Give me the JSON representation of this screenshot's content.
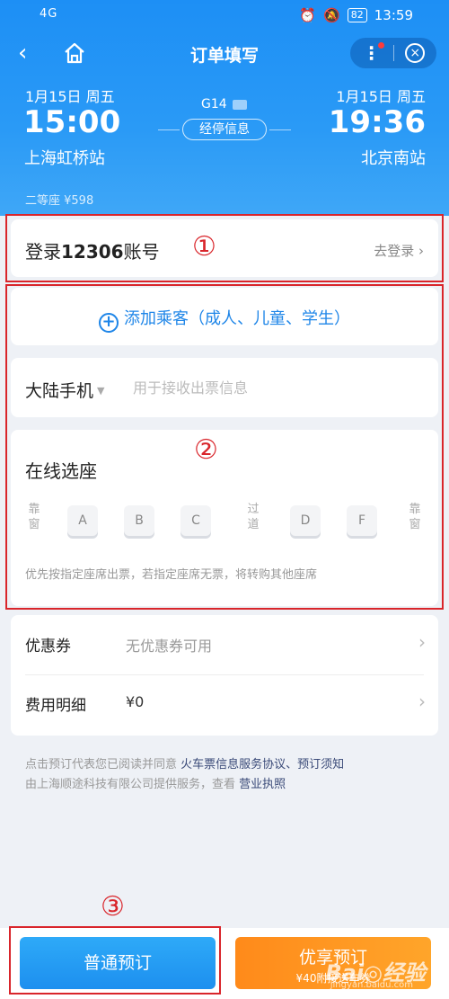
{
  "status": {
    "signal": "4G",
    "battery": "82",
    "time": "13:59"
  },
  "nav": {
    "title": "订单填写",
    "back": "‹",
    "more": "⋮",
    "close": "×"
  },
  "trip": {
    "dep_date": "1月15日 周五",
    "dep_time": "15:00",
    "dep_station": "上海虹桥站",
    "arr_date": "1月15日 周五",
    "arr_time": "19:36",
    "arr_station": "北京南站",
    "train_no": "G14",
    "stops_label": "经停信息",
    "seat_price": "二等座 ¥598"
  },
  "annotations": [
    "①",
    "②",
    "③"
  ],
  "login": {
    "prefix": "登录",
    "bold": "12306",
    "suffix": "账号",
    "link": "去登录 ›"
  },
  "passenger": {
    "add_label": "添加乘客（成人、儿童、学生）",
    "plus": "+"
  },
  "phone": {
    "label": "大陆手机",
    "caret": "▼",
    "placeholder": "用于接收出票信息"
  },
  "seat": {
    "title": "在线选座",
    "left_side": "靠窗",
    "aisle": "过道",
    "right_side": "靠窗",
    "seats": [
      "A",
      "B",
      "C",
      "D",
      "F"
    ],
    "note": "优先按指定座席出票，若指定座席无票，将转购其他座席"
  },
  "coupon": {
    "label": "优惠券",
    "value": "无优惠券可用"
  },
  "fee": {
    "label": "费用明细",
    "value": "¥0"
  },
  "agreement": {
    "line1_prefix": "点击预订代表您已阅读并同意 ",
    "line1_link": "火车票信息服务协议、预订须知",
    "line2_prefix": "由上海顺途科技有限公司提供服务，查看 ",
    "line2_link": "营业执照"
  },
  "buttons": {
    "normal": "普通预订",
    "vip": "优享预订",
    "vip_sub": "¥40附接送车券"
  },
  "watermark": {
    "text": "Bai◎经验",
    "sub": "jingyan.baidu.com"
  },
  "colors": {
    "primary": "#1d8ff5",
    "annotation": "#d9252b",
    "orange": "#ff8a1a"
  }
}
